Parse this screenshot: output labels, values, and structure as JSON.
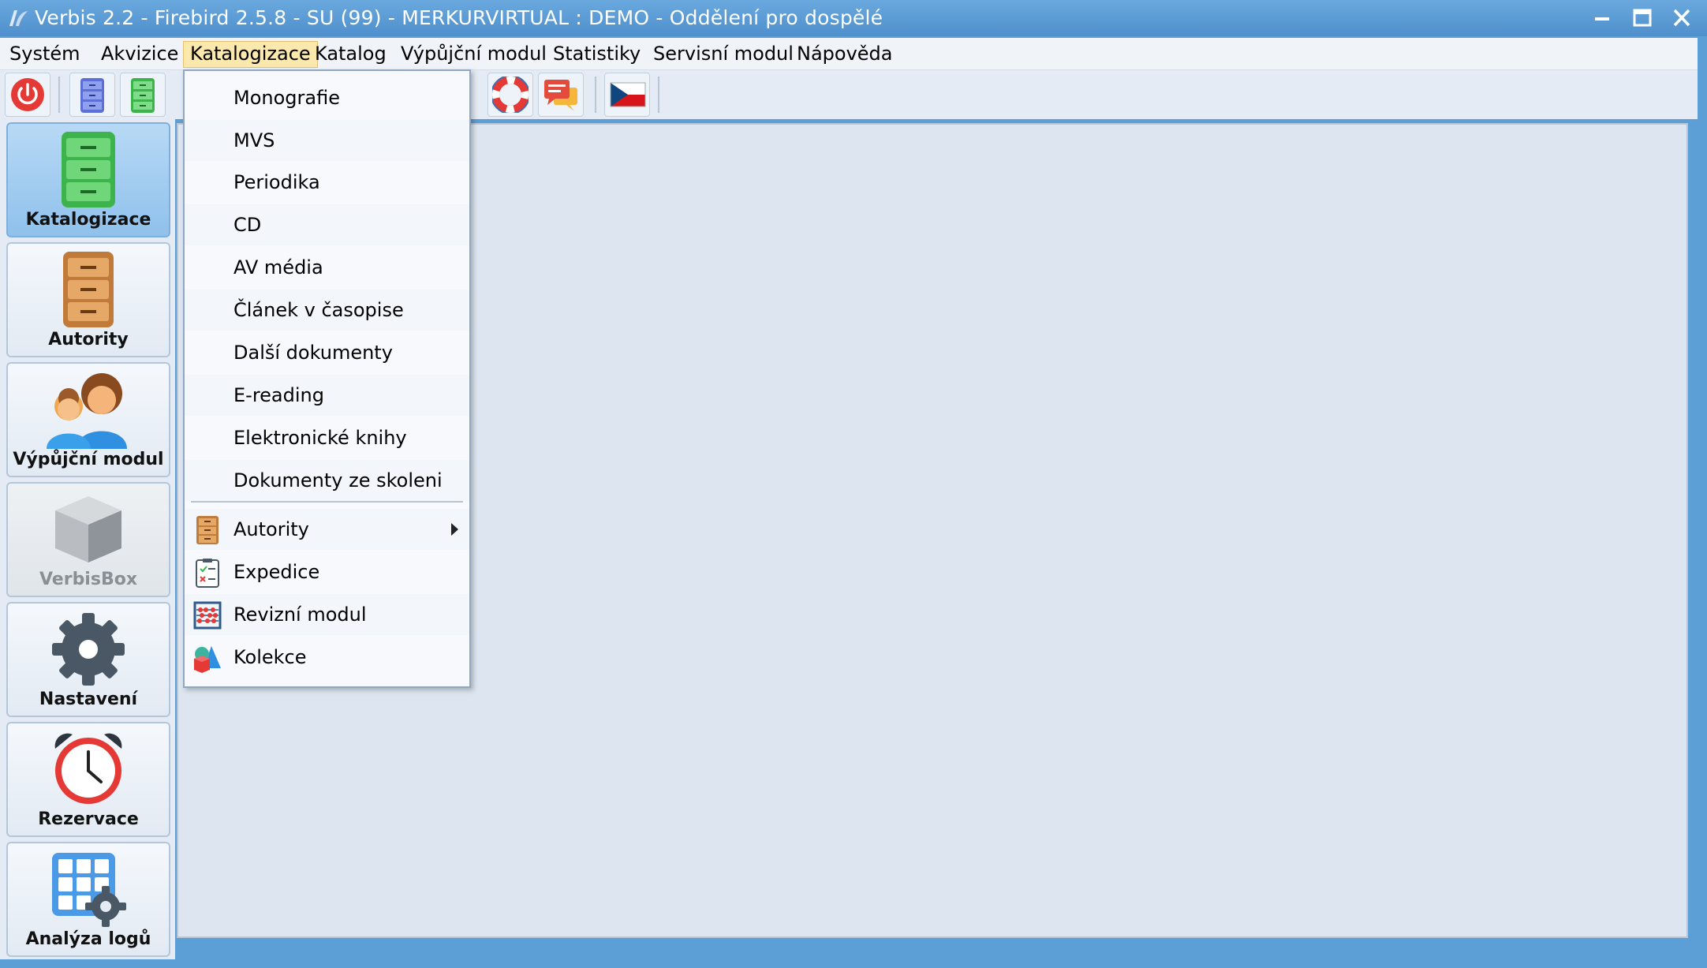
{
  "window": {
    "title": "Verbis 2.2 - Firebird 2.5.8 - SU (99) - MERKURVIRTUAL : DEMO - Oddělení pro dospělé"
  },
  "menubar": {
    "items": [
      {
        "label": "Systém"
      },
      {
        "label": "Akvizice"
      },
      {
        "label": "Katalogizace",
        "active": true
      },
      {
        "label": "Katalog"
      },
      {
        "label": "Výpůjční modul"
      },
      {
        "label": "Statistiky"
      },
      {
        "label": "Servisní modul"
      },
      {
        "label": "Nápověda"
      }
    ]
  },
  "toolbar": {
    "buttons": [
      {
        "icon": "power-icon"
      },
      {
        "icon": "blue-cabinet-icon"
      },
      {
        "icon": "green-cabinet-icon"
      },
      {
        "icon": "lifebuoy-icon"
      },
      {
        "icon": "chat-icon"
      },
      {
        "icon": "czech-flag-icon"
      }
    ]
  },
  "leftnav": {
    "tiles": [
      {
        "label": "Katalogizace",
        "icon": "green-cabinet-icon",
        "active": true
      },
      {
        "label": "Autority",
        "icon": "brown-cabinet-icon"
      },
      {
        "label": "Výpůjční modul",
        "icon": "people-icon"
      },
      {
        "label": "VerbisBox",
        "icon": "box-icon",
        "disabled": true
      },
      {
        "label": "Nastavení",
        "icon": "gear-icon"
      },
      {
        "label": "Rezervace",
        "icon": "alarm-clock-icon"
      },
      {
        "label": "Analýza logů",
        "icon": "grid-gear-icon"
      }
    ]
  },
  "dropdown": {
    "items": [
      {
        "label": "Monografie"
      },
      {
        "label": "MVS"
      },
      {
        "label": "Periodika"
      },
      {
        "label": "CD"
      },
      {
        "label": "AV média"
      },
      {
        "label": "Článek v časopise"
      },
      {
        "label": "Další dokumenty"
      },
      {
        "label": "E-reading"
      },
      {
        "label": "Elektronické knihy"
      },
      {
        "label": "Dokumenty ze skoleni"
      }
    ],
    "items2": [
      {
        "label": "Autority",
        "icon": "brown-cabinet-icon",
        "submenu": true
      },
      {
        "label": "Expedice",
        "icon": "checklist-icon"
      },
      {
        "label": "Revizní modul",
        "icon": "abacus-icon"
      },
      {
        "label": "Kolekce",
        "icon": "shapes-icon"
      }
    ]
  },
  "colors": {
    "accent": "#5b9fd6",
    "menu_highlight": "#fbe8ad",
    "active_tile": "#8fc1ec"
  }
}
